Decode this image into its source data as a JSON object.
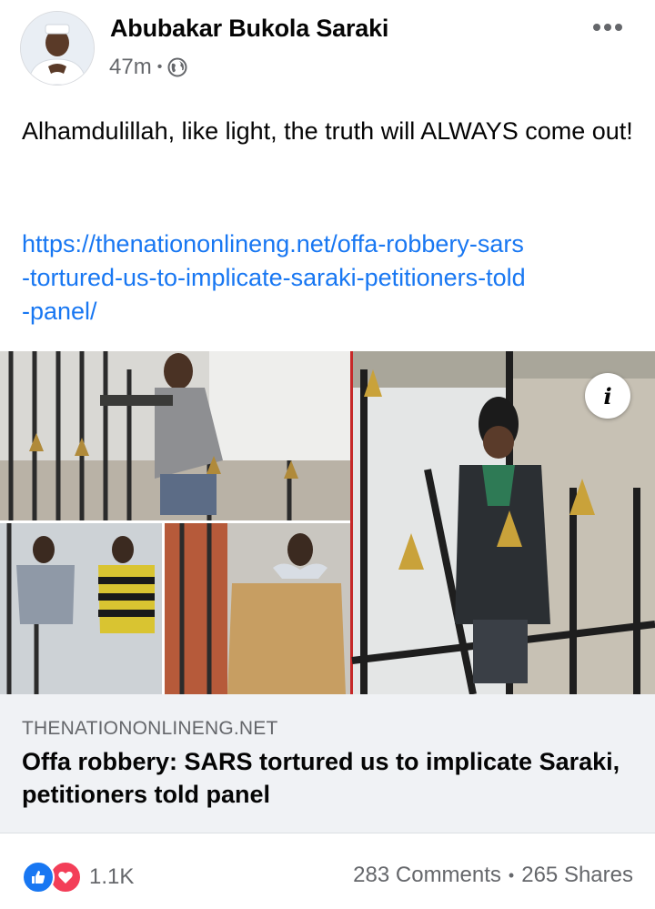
{
  "post": {
    "author": "Abubakar Bukola Saraki",
    "time": "47m",
    "meta_separator": "•",
    "audience_icon": "globe-icon",
    "more_icon": "more-horizontal-icon",
    "text": "Alhamdulillah, like light, the truth will ALWAYS come out!",
    "link_lines": [
      "https://thenationonlineng.net/offa-robbery-sars",
      "-tortured-us-to-implicate-saraki-petitioners-told",
      "-panel/"
    ]
  },
  "link_preview": {
    "domain": "THENATIONONLINENG.NET",
    "headline": "Offa robbery: SARS tortured us to implicate Saraki, petitioners told panel",
    "info_icon": "i"
  },
  "footer": {
    "reaction_count": "1.1K",
    "comments": "283 Comments",
    "separator": "•",
    "shares": "265 Shares"
  },
  "colors": {
    "link": "#1877f2",
    "secondary_text": "#65676b",
    "like": "#1877f2",
    "love": "#f33e58",
    "card_bg": "#f0f2f5"
  }
}
